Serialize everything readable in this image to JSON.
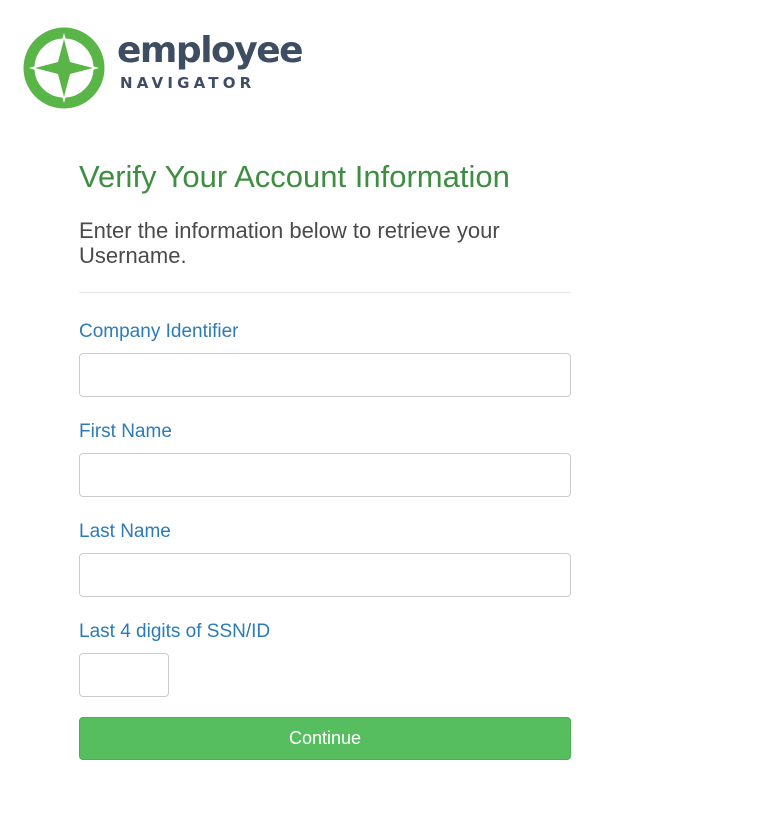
{
  "brand": {
    "name": "employee",
    "tagline": "NAVIGATOR",
    "logo_icon": "compass-star-icon",
    "colors": {
      "logo_green": "#59b548",
      "logo_text": "#3f4d62"
    }
  },
  "page": {
    "title": "Verify Your Account Information",
    "subtitle": "Enter the information below to retrieve your Username."
  },
  "form": {
    "company_identifier": {
      "label": "Company Identifier",
      "value": "",
      "placeholder": ""
    },
    "first_name": {
      "label": "First Name",
      "value": "",
      "placeholder": ""
    },
    "last_name": {
      "label": "Last Name",
      "value": "",
      "placeholder": ""
    },
    "ssn_last4": {
      "label": "Last 4 digits of SSN/ID",
      "value": "",
      "placeholder": ""
    },
    "submit_label": "Continue"
  },
  "colors": {
    "title": "#3e8e41",
    "labels": "#2c7bb8",
    "button": "#56be5f"
  }
}
